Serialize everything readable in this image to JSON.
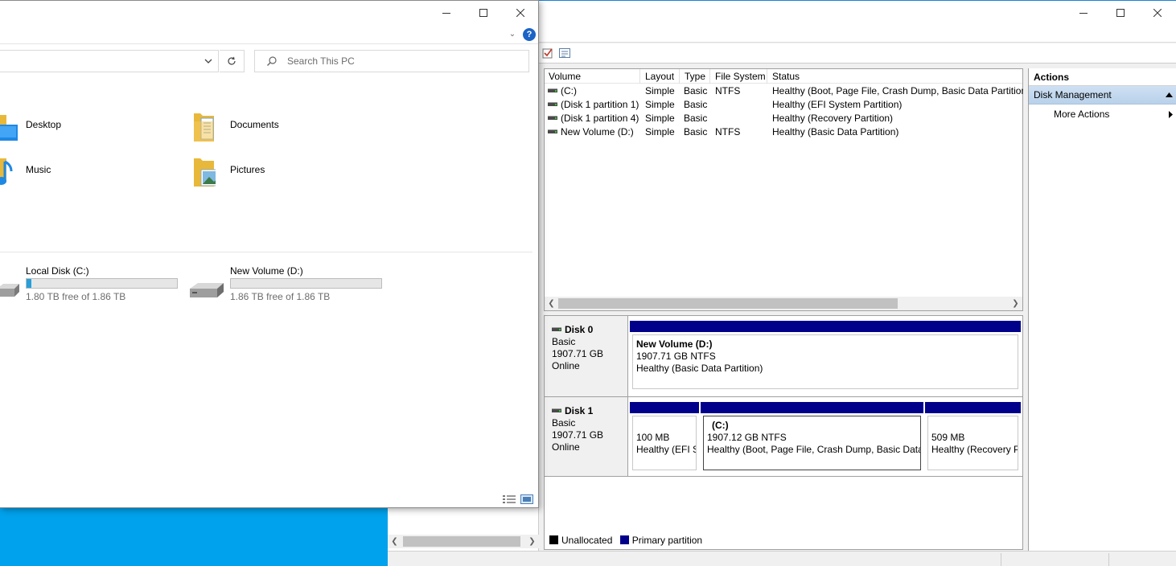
{
  "explorer": {
    "search_placeholder": "Search This PC",
    "help_label": "?",
    "folders": [
      {
        "label": "Desktop",
        "icon": "desktop-folder-icon"
      },
      {
        "label": "Documents",
        "icon": "documents-folder-icon"
      },
      {
        "label": "Music",
        "icon": "music-folder-icon"
      },
      {
        "label": "Pictures",
        "icon": "pictures-folder-icon"
      }
    ],
    "drives": [
      {
        "label": "Local Disk (C:)",
        "free_text": "1.80 TB free of 1.86 TB",
        "used_fraction": 0.032
      },
      {
        "label": "New Volume (D:)",
        "free_text": "1.86 TB free of 1.86 TB",
        "used_fraction": 0.0
      }
    ]
  },
  "disk_management": {
    "columns": [
      "Volume",
      "Layout",
      "Type",
      "File System",
      "Status"
    ],
    "volumes": [
      {
        "volume": "(C:)",
        "layout": "Simple",
        "type": "Basic",
        "fs": "NTFS",
        "status": "Healthy (Boot, Page File, Crash Dump, Basic Data Partition)"
      },
      {
        "volume": "(Disk 1 partition 1)",
        "layout": "Simple",
        "type": "Basic",
        "fs": "",
        "status": "Healthy (EFI System Partition)"
      },
      {
        "volume": "(Disk 1 partition 4)",
        "layout": "Simple",
        "type": "Basic",
        "fs": "",
        "status": "Healthy (Recovery Partition)"
      },
      {
        "volume": "New Volume (D:)",
        "layout": "Simple",
        "type": "Basic",
        "fs": "NTFS",
        "status": "Healthy (Basic Data Partition)"
      }
    ],
    "disks": [
      {
        "name": "Disk 0",
        "type": "Basic",
        "size": "1907.71 GB",
        "state": "Online",
        "partitions": [
          {
            "title": "New Volume  (D:)",
            "line1": "1907.71 GB NTFS",
            "line2": "Healthy (Basic Data Partition)"
          }
        ]
      },
      {
        "name": "Disk 1",
        "type": "Basic",
        "size": "1907.71 GB",
        "state": "Online",
        "partitions": [
          {
            "title": "",
            "line1": "100 MB",
            "line2": "Healthy (EFI S"
          },
          {
            "title": "(C:)",
            "line1": "1907.12 GB NTFS",
            "line2": "Healthy (Boot, Page File, Crash Dump, Basic Data I"
          },
          {
            "title": "",
            "line1": "509 MB",
            "line2": "Healthy (Recovery P"
          }
        ]
      }
    ],
    "legend": [
      {
        "label": "Unallocated",
        "color": "#000000"
      },
      {
        "label": "Primary partition",
        "color": "#00008b"
      }
    ],
    "actions": {
      "header": "Actions",
      "section": "Disk Management",
      "items": [
        "More Actions"
      ]
    }
  },
  "colors": {
    "desktop": "#00a2ed",
    "primary_partition": "#00008b",
    "drive_fill": "#26a0da",
    "help_blue": "#1b63c6"
  }
}
